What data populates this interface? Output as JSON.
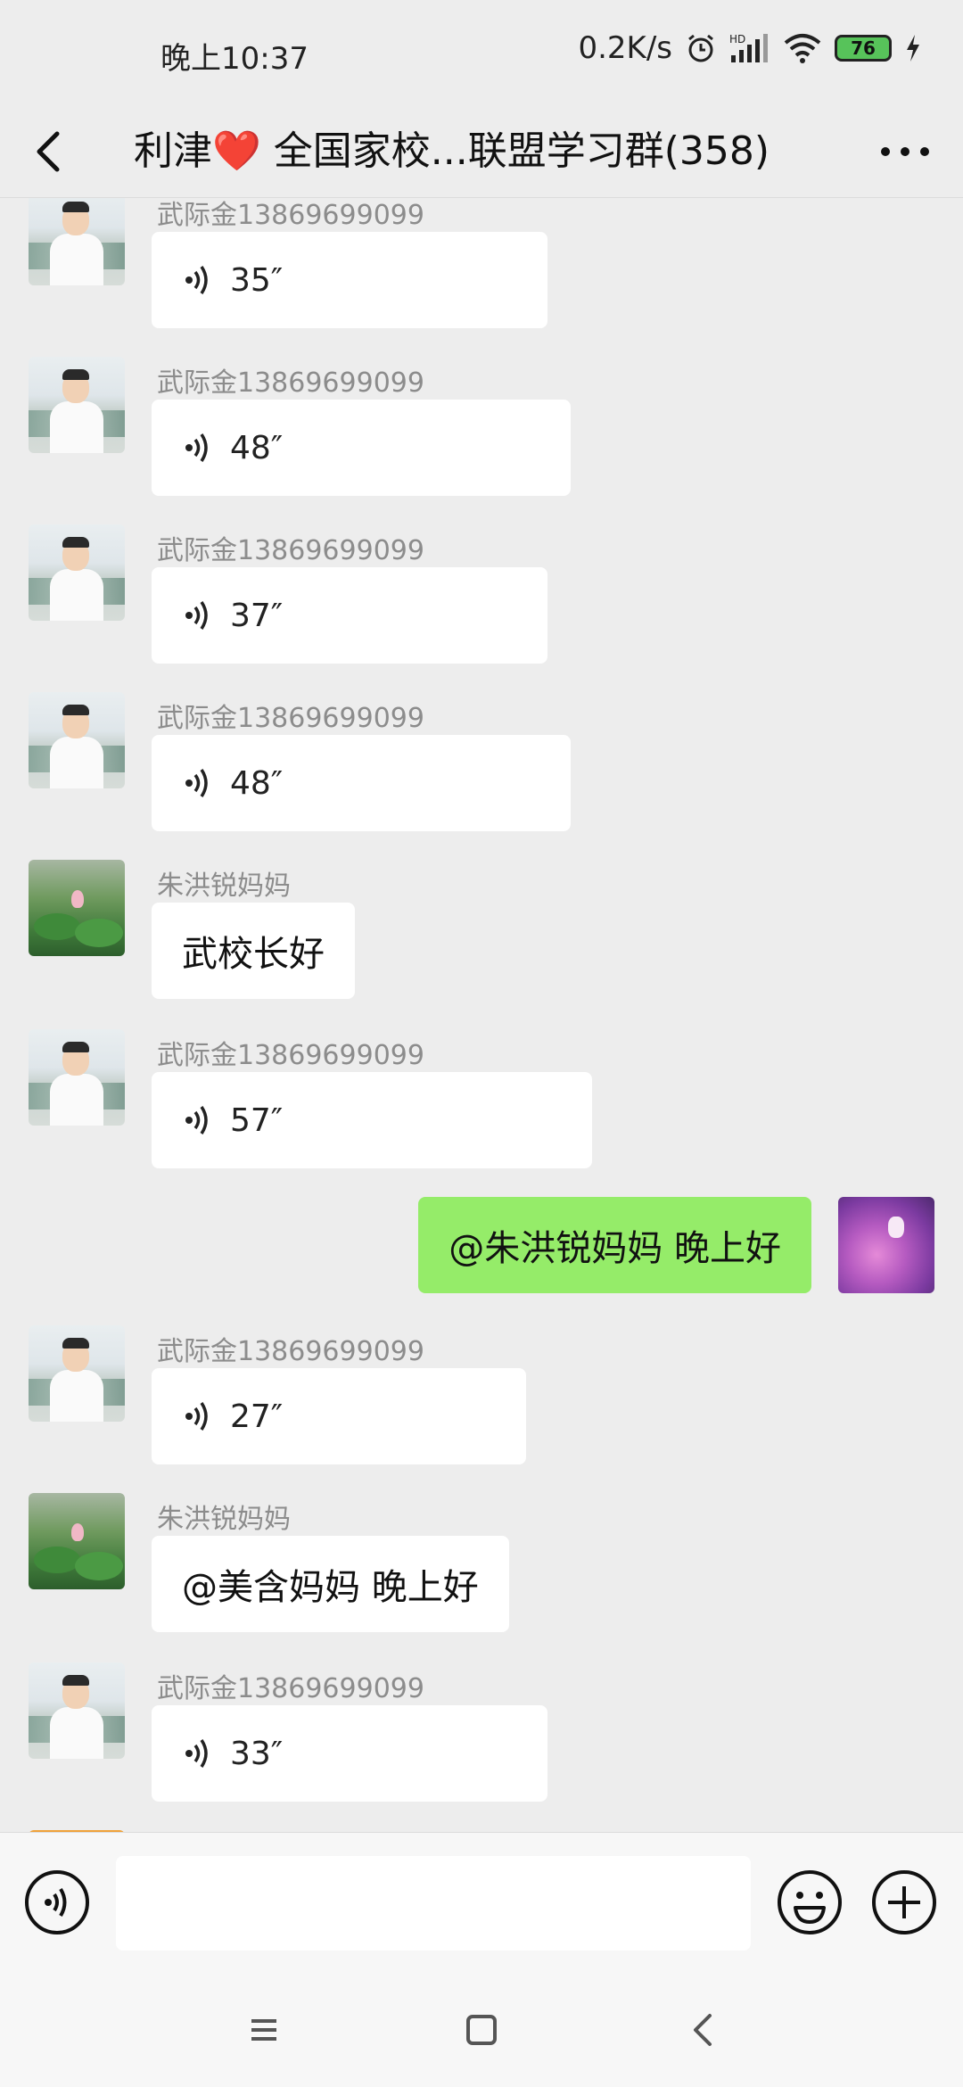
{
  "status_bar": {
    "time": "晚上10:37",
    "net_speed": "0.2K/s",
    "battery": "76",
    "icons": [
      "alarm-icon",
      "hd-signal-icon",
      "wifi-icon",
      "battery-icon",
      "charging-icon"
    ]
  },
  "header": {
    "title": "利津❤️ 全国家校...联盟学习群(358)",
    "back_icon": "back-arrow-icon",
    "more_icon": "more-dots-icon"
  },
  "messages": [
    {
      "sender": "武际金13869699099",
      "type": "voice",
      "duration": "35″"
    },
    {
      "sender": "武际金13869699099",
      "type": "voice",
      "duration": "48″"
    },
    {
      "sender": "武际金13869699099",
      "type": "voice",
      "duration": "37″"
    },
    {
      "sender": "武际金13869699099",
      "type": "voice",
      "duration": "48″"
    },
    {
      "sender": "朱洪锐妈妈",
      "type": "text",
      "text": "武校长好"
    },
    {
      "sender": "武际金13869699099",
      "type": "voice",
      "duration": "57″"
    },
    {
      "sender": "",
      "type": "text",
      "self": true,
      "text": "@朱洪锐妈妈  晚上好"
    },
    {
      "sender": "武际金13869699099",
      "type": "voice",
      "duration": "27″"
    },
    {
      "sender": "朱洪锐妈妈",
      "type": "text",
      "text": "@美含妈妈  晚上好"
    },
    {
      "sender": "武际金13869699099",
      "type": "voice",
      "duration": "33″"
    }
  ],
  "input_bar": {
    "placeholder": "",
    "value": ""
  },
  "colors": {
    "background": "#ededed",
    "self_bubble": "#95ec69",
    "other_bubble": "#ffffff",
    "sender_name": "#8c8c8c"
  }
}
